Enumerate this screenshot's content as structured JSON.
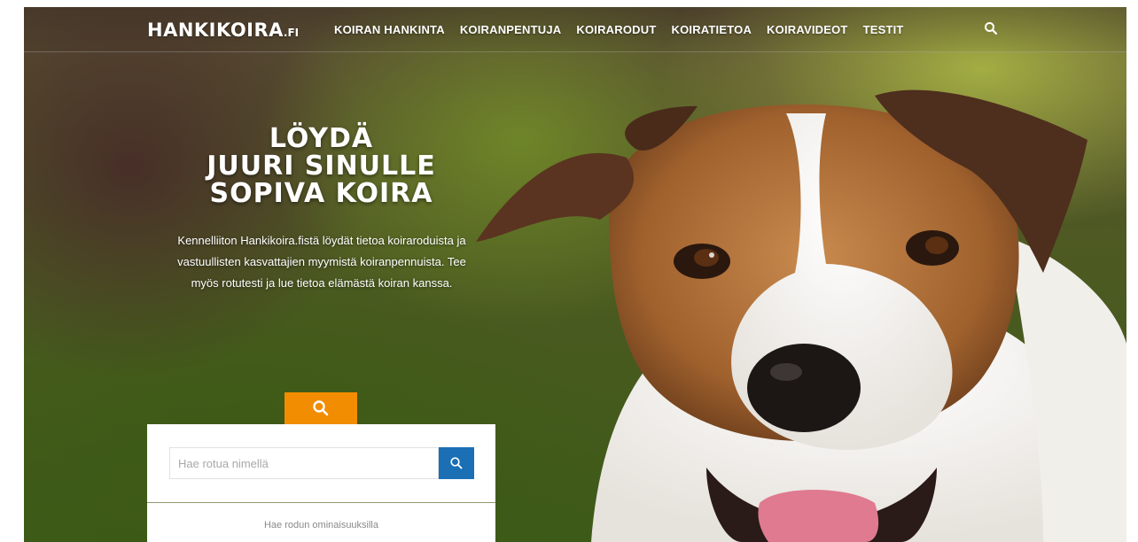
{
  "header": {
    "logo": {
      "main": "HANKIKOIRA",
      "tld": ".FI"
    },
    "menu": [
      {
        "label": "KOIRAN HANKINTA"
      },
      {
        "label": "KOIRANPENTUJA"
      },
      {
        "label": "KOIRARODUT"
      },
      {
        "label": "KOIRATIETOA"
      },
      {
        "label": "KOIRAVIDEOT"
      },
      {
        "label": "TESTIT"
      }
    ],
    "search_icon": "search-icon"
  },
  "hero": {
    "headline": [
      "LÖYDÄ",
      "JUURI SINULLE",
      "SOPIVA KOIRA"
    ],
    "intro": "Kennelliiton Hankikoira.fistä löydät tietoa koiraroduista ja vastuullisten kasvattajien myymistä koiranpennuista. Tee myös rotutesti ja lue tietoa elämästä koiran kanssa."
  },
  "search": {
    "tab_icon": "search-icon",
    "placeholder": "Hae rotua nimellä",
    "button_icon": "search-icon",
    "advanced_link": "Hae rodun ominaisuuksilla"
  },
  "colors": {
    "accent_orange": "#f28c00",
    "button_blue": "#1a6fb5",
    "text_white": "#ffffff"
  }
}
